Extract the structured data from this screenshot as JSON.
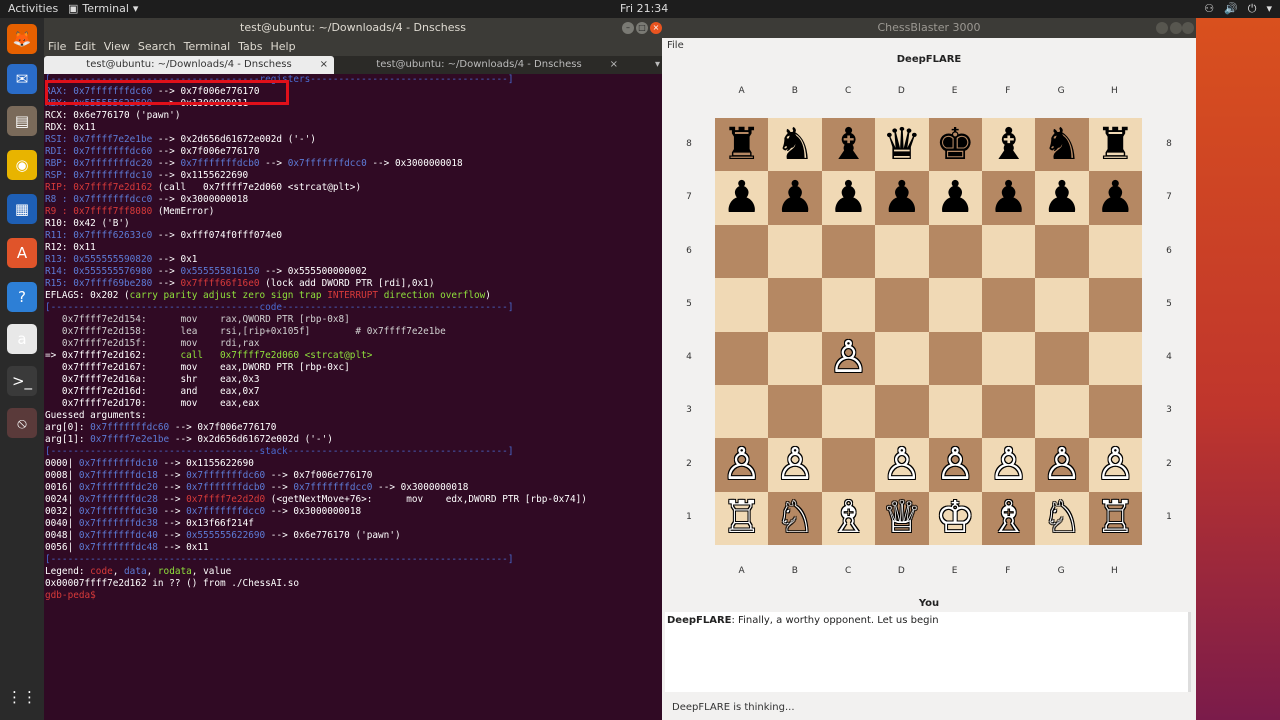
{
  "topbar": {
    "activities": "Activities",
    "app": "Terminal",
    "app_arrow": "▾",
    "clock": "Fri 21:34",
    "tray": [
      "⚇",
      "🔊",
      "⏻",
      "▾"
    ]
  },
  "dock": [
    {
      "name": "firefox-icon",
      "glyph": "🦊",
      "bg": "#e66000"
    },
    {
      "name": "thunderbird-icon",
      "glyph": "✉",
      "bg": "#2a6cc8"
    },
    {
      "name": "files-icon",
      "glyph": "▤",
      "bg": "#7a6a5a"
    },
    {
      "name": "rhythmbox-icon",
      "glyph": "◉",
      "bg": "#e8b400"
    },
    {
      "name": "libreoffice-writer-icon",
      "glyph": "▦",
      "bg": "#1e5fb5"
    },
    {
      "name": "software-center-icon",
      "glyph": "A",
      "bg": "#e0542a"
    },
    {
      "name": "help-icon",
      "glyph": "?",
      "bg": "#2d7fd6"
    },
    {
      "name": "amazon-icon",
      "glyph": "a",
      "bg": "#e8e8e8"
    },
    {
      "name": "terminal-icon",
      "glyph": ">_",
      "bg": "#3a3a3a"
    },
    {
      "name": "no-entry-icon",
      "glyph": "⦸",
      "bg": "#5a3a3a"
    },
    {
      "name": "show-apps-icon",
      "glyph": "⋮⋮",
      "bg": "transparent"
    }
  ],
  "terminal": {
    "title": "test@ubuntu: ~/Downloads/4 - Dnschess",
    "menu": [
      "File",
      "Edit",
      "View",
      "Search",
      "Terminal",
      "Tabs",
      "Help"
    ],
    "tabs": [
      {
        "label": "test@ubuntu: ~/Downloads/4 - Dnschess",
        "close": "×"
      },
      {
        "label": "test@ubuntu: ~/Downloads/4 - Dnschess",
        "close": "×"
      }
    ],
    "more": "▾",
    "lines": [
      [
        {
          "c": "sep",
          "t": "[-------------------------------------registers-----------------------------------]"
        }
      ],
      [
        {
          "c": "blue",
          "t": "RAX: 0x7fffffffdc60 "
        },
        {
          "c": "",
          "t": "--> 0x7f006e776170"
        }
      ],
      [
        {
          "c": "blue",
          "t": "RBX: 0x555555622690 "
        },
        {
          "c": "",
          "t": "--> 0x1300000011"
        }
      ],
      [
        {
          "c": "",
          "t": "RCX: 0x6e776170 ('pawn')"
        }
      ],
      [
        {
          "c": "",
          "t": "RDX: 0x11"
        }
      ],
      [
        {
          "c": "blue",
          "t": "RSI: 0x7ffff7e2e1be "
        },
        {
          "c": "",
          "t": "--> 0x2d656d61672e002d ('-')"
        }
      ],
      [
        {
          "c": "blue",
          "t": "RDI: 0x7fffffffdc60 "
        },
        {
          "c": "",
          "t": "--> 0x7f006e776170"
        }
      ],
      [
        {
          "c": "blue",
          "t": "RBP: 0x7fffffffdc20 "
        },
        {
          "c": "",
          "t": "--> "
        },
        {
          "c": "blue",
          "t": "0x7fffffffdcb0 "
        },
        {
          "c": "",
          "t": "--> "
        },
        {
          "c": "blue",
          "t": "0x7fffffffdcc0 "
        },
        {
          "c": "",
          "t": "--> 0x3000000018"
        }
      ],
      [
        {
          "c": "blue",
          "t": "RSP: 0x7fffffffdc10 "
        },
        {
          "c": "",
          "t": "--> 0x1155622690"
        }
      ],
      [
        {
          "c": "red",
          "t": "RIP: 0x7ffff7e2d162 "
        },
        {
          "c": "",
          "t": "(call   0x7ffff7e2d060 <strcat@plt>)"
        }
      ],
      [
        {
          "c": "blue",
          "t": "R8 : 0x7fffffffdcc0 "
        },
        {
          "c": "",
          "t": "--> 0x3000000018"
        }
      ],
      [
        {
          "c": "red",
          "t": "R9 : 0x7ffff7ff8080 "
        },
        {
          "c": "",
          "t": "(MemError)"
        }
      ],
      [
        {
          "c": "",
          "t": "R10: 0x42 ('B')"
        }
      ],
      [
        {
          "c": "blue",
          "t": "R11: 0x7ffff62633c0 "
        },
        {
          "c": "",
          "t": "--> 0xfff074f0fff074e0"
        }
      ],
      [
        {
          "c": "",
          "t": "R12: 0x11"
        }
      ],
      [
        {
          "c": "blue",
          "t": "R13: 0x555555590820 "
        },
        {
          "c": "",
          "t": "--> 0x1"
        }
      ],
      [
        {
          "c": "blue",
          "t": "R14: 0x555555576980 "
        },
        {
          "c": "",
          "t": "--> "
        },
        {
          "c": "blue",
          "t": "0x555555816150 "
        },
        {
          "c": "",
          "t": "--> 0x555500000002"
        }
      ],
      [
        {
          "c": "blue",
          "t": "R15: 0x7ffff69be280 "
        },
        {
          "c": "",
          "t": "--> "
        },
        {
          "c": "red",
          "t": "0x7ffff66f16e0 "
        },
        {
          "c": "",
          "t": "(lock add DWORD PTR [rdi],0x1)"
        }
      ],
      [
        {
          "c": "",
          "t": "EFLAGS: 0x202 ("
        },
        {
          "c": "green",
          "t": "carry parity adjust zero sign trap "
        },
        {
          "c": "red",
          "t": "INTERRUPT "
        },
        {
          "c": "green",
          "t": "direction overflow"
        },
        {
          "c": "",
          "t": ")"
        }
      ],
      [
        {
          "c": "sep",
          "t": "[-------------------------------------code----------------------------------------]"
        }
      ],
      [
        {
          "c": "gray",
          "t": "   0x7ffff7e2d154:      mov    rax,QWORD PTR [rbp-0x8]"
        }
      ],
      [
        {
          "c": "gray",
          "t": "   0x7ffff7e2d158:      lea    rsi,[rip+0x105f]        # 0x7ffff7e2e1be"
        }
      ],
      [
        {
          "c": "gray",
          "t": "   0x7ffff7e2d15f:      mov    rdi,rax"
        }
      ],
      [
        {
          "c": "",
          "t": "=> 0x7ffff7e2d162:      "
        },
        {
          "c": "green",
          "t": "call   0x7ffff7e2d060 <strcat@plt>"
        }
      ],
      [
        {
          "c": "",
          "t": "   0x7ffff7e2d167:      mov    eax,DWORD PTR [rbp-0xc]"
        }
      ],
      [
        {
          "c": "",
          "t": "   0x7ffff7e2d16a:      shr    eax,0x3"
        }
      ],
      [
        {
          "c": "",
          "t": "   0x7ffff7e2d16d:      and    eax,0x7"
        }
      ],
      [
        {
          "c": "",
          "t": "   0x7ffff7e2d170:      mov    eax,eax"
        }
      ],
      [
        {
          "c": "",
          "t": "Guessed arguments:"
        }
      ],
      [
        {
          "c": "",
          "t": "arg[0]: "
        },
        {
          "c": "blue",
          "t": "0x7fffffffdc60 "
        },
        {
          "c": "",
          "t": "--> 0x7f006e776170"
        }
      ],
      [
        {
          "c": "",
          "t": "arg[1]: "
        },
        {
          "c": "blue",
          "t": "0x7ffff7e2e1be "
        },
        {
          "c": "",
          "t": "--> 0x2d656d61672e002d ('-')"
        }
      ],
      [
        {
          "c": "sep",
          "t": "[-------------------------------------stack---------------------------------------]"
        }
      ],
      [
        {
          "c": "",
          "t": "0000| "
        },
        {
          "c": "blue",
          "t": "0x7fffffffdc10 "
        },
        {
          "c": "",
          "t": "--> 0x1155622690"
        }
      ],
      [
        {
          "c": "",
          "t": "0008| "
        },
        {
          "c": "blue",
          "t": "0x7fffffffdc18 "
        },
        {
          "c": "",
          "t": "--> "
        },
        {
          "c": "blue",
          "t": "0x7fffffffdc60 "
        },
        {
          "c": "",
          "t": "--> 0x7f006e776170"
        }
      ],
      [
        {
          "c": "",
          "t": "0016| "
        },
        {
          "c": "blue",
          "t": "0x7fffffffdc20 "
        },
        {
          "c": "",
          "t": "--> "
        },
        {
          "c": "blue",
          "t": "0x7fffffffdcb0 "
        },
        {
          "c": "",
          "t": "--> "
        },
        {
          "c": "blue",
          "t": "0x7fffffffdcc0 "
        },
        {
          "c": "",
          "t": "--> 0x3000000018"
        }
      ],
      [
        {
          "c": "",
          "t": "0024| "
        },
        {
          "c": "blue",
          "t": "0x7fffffffdc28 "
        },
        {
          "c": "",
          "t": "--> "
        },
        {
          "c": "red",
          "t": "0x7ffff7e2d2d0 "
        },
        {
          "c": "",
          "t": "(<getNextMove+76>:      mov    edx,DWORD PTR [rbp-0x74])"
        }
      ],
      [
        {
          "c": "",
          "t": "0032| "
        },
        {
          "c": "blue",
          "t": "0x7fffffffdc30 "
        },
        {
          "c": "",
          "t": "--> "
        },
        {
          "c": "blue",
          "t": "0x7fffffffdcc0 "
        },
        {
          "c": "",
          "t": "--> 0x3000000018"
        }
      ],
      [
        {
          "c": "",
          "t": "0040| "
        },
        {
          "c": "blue",
          "t": "0x7fffffffdc38 "
        },
        {
          "c": "",
          "t": "--> 0x13f66f214f"
        }
      ],
      [
        {
          "c": "",
          "t": "0048| "
        },
        {
          "c": "blue",
          "t": "0x7fffffffdc40 "
        },
        {
          "c": "",
          "t": "--> "
        },
        {
          "c": "blue",
          "t": "0x555555622690 "
        },
        {
          "c": "",
          "t": "--> 0x6e776170 ('pawn')"
        }
      ],
      [
        {
          "c": "",
          "t": "0056| "
        },
        {
          "c": "blue",
          "t": "0x7fffffffdc48 "
        },
        {
          "c": "",
          "t": "--> 0x11"
        }
      ],
      [
        {
          "c": "sep",
          "t": "[---------------------------------------------------------------------------------]"
        }
      ],
      [
        {
          "c": "",
          "t": "Legend: "
        },
        {
          "c": "red",
          "t": "code"
        },
        {
          "c": "",
          "t": ", "
        },
        {
          "c": "blue",
          "t": "data"
        },
        {
          "c": "",
          "t": ", "
        },
        {
          "c": "green",
          "t": "rodata"
        },
        {
          "c": "",
          "t": ", value"
        }
      ],
      [
        {
          "c": "",
          "t": "0x00007ffff7e2d162 in ?? () from ./ChessAI.so"
        }
      ],
      [
        {
          "c": "red",
          "t": "gdb-peda$ "
        }
      ]
    ]
  },
  "chess": {
    "title": "ChessBlaster 3000",
    "menu": "File",
    "opponent": "DeepFLARE",
    "player": "You",
    "files": [
      "A",
      "B",
      "C",
      "D",
      "E",
      "F",
      "G",
      "H"
    ],
    "ranks": [
      "8",
      "7",
      "6",
      "5",
      "4",
      "3",
      "2",
      "1"
    ],
    "board": [
      [
        "♜",
        "♞",
        "♝",
        "♛",
        "♚",
        "♝",
        "♞",
        "♜"
      ],
      [
        "♟",
        "♟",
        "♟",
        "♟",
        "♟",
        "♟",
        "♟",
        "♟"
      ],
      [
        "",
        "",
        "",
        "",
        "",
        "",
        "",
        ""
      ],
      [
        "",
        "",
        "",
        "",
        "",
        "",
        "",
        ""
      ],
      [
        "",
        "",
        "♙",
        "",
        "",
        "",
        "",
        ""
      ],
      [
        "",
        "",
        "",
        "",
        "",
        "",
        "",
        ""
      ],
      [
        "♙",
        "♙",
        "",
        "♙",
        "♙",
        "♙",
        "♙",
        "♙"
      ],
      [
        "♖",
        "♘",
        "♗",
        "♕",
        "♔",
        "♗",
        "♘",
        "♖"
      ]
    ],
    "chat": [
      {
        "speaker": "DeepFLARE",
        "text": ": Finally, a worthy opponent. Let us begin"
      }
    ],
    "status": "DeepFLARE is thinking..."
  }
}
